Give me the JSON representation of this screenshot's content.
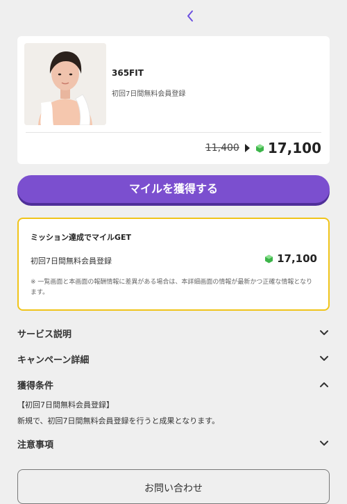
{
  "nav": {
    "back_icon": "chevron-left-icon",
    "accent": "#6b4fe0"
  },
  "offer": {
    "title": "365FIT",
    "subtitle": "初回7日間無料会員登録",
    "old_price": "11,400",
    "new_price": "17,100",
    "gem_icon": "green-gem-icon"
  },
  "cta": {
    "label": "マイルを獲得する",
    "color": "#7b4fcf"
  },
  "mission": {
    "heading": "ミッション達成でマイルGET",
    "item_label": "初回7日間無料会員登録",
    "item_price": "17,100",
    "note": "※ 一覧画面と本画面の報酬情報に差異がある場合は、本詳細画面の情報が最新かつ正確な情報となります。",
    "border_color": "#f0c419"
  },
  "sections": {
    "service": {
      "label": "サービス説明",
      "expanded": false
    },
    "campaign": {
      "label": "キャンペーン詳細",
      "expanded": false
    },
    "conditions": {
      "label": "獲得条件",
      "expanded": true,
      "line1": "【初回7日間無料会員登録】",
      "line2": "新規で、初回7日間無料会員登録を行うと成果となります。"
    },
    "notes": {
      "label": "注意事項",
      "expanded": false
    }
  },
  "contact": {
    "label": "お問い合わせ"
  }
}
